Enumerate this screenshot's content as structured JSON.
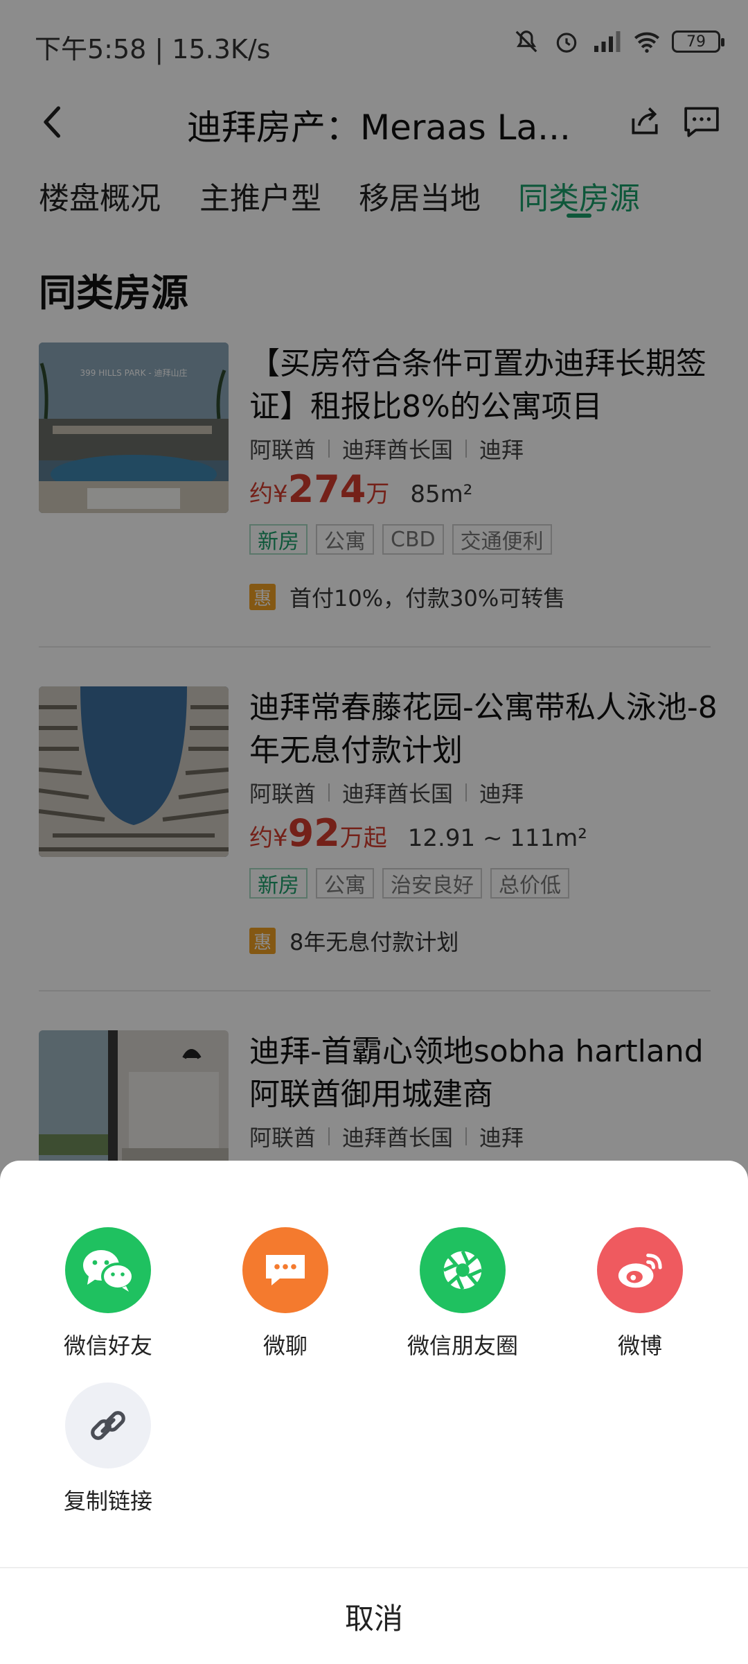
{
  "status_bar": {
    "text": "下午5:58 | 15.3K/s",
    "battery": "79"
  },
  "nav": {
    "title": "迪拜房产：Meraas La..."
  },
  "tabs": [
    {
      "label": "楼盘概况"
    },
    {
      "label": "主推户型"
    },
    {
      "label": "移居当地"
    },
    {
      "label": "同类房源"
    }
  ],
  "section": {
    "title": "同类房源"
  },
  "listings": [
    {
      "title": "【买房符合条件可置办迪拜长期签证】租报比8%的公寓项目",
      "locations": [
        "阿联酋",
        "迪拜酋长国",
        "迪拜"
      ],
      "price_prefix": "约¥",
      "price_num": "274",
      "price_unit": "万",
      "area": "85m²",
      "tags": [
        "新房",
        "公寓",
        "CBD",
        "交通便利"
      ],
      "promo_badge": "惠",
      "promo": "首付10%，付款30%可转售",
      "thumb_text": "399 HILLS PARK - 迪拜山庄"
    },
    {
      "title": "迪拜常春藤花园-公寓带私人泳池-8年无息付款计划",
      "locations": [
        "阿联酋",
        "迪拜酋长国",
        "迪拜"
      ],
      "price_prefix": "约¥",
      "price_num": "92",
      "price_unit": "万起",
      "area": "12.91 ~ 111m²",
      "tags": [
        "新房",
        "公寓",
        "治安良好",
        "总价低"
      ],
      "promo_badge": "惠",
      "promo": "8年无息付款计划"
    },
    {
      "title": "迪拜-首霸心领地sobha hartland阿联酋御用城建商",
      "locations": [
        "阿联酋",
        "迪拜酋长国",
        "迪拜"
      ]
    }
  ],
  "share_sheet": {
    "items": [
      {
        "label": "微信好友",
        "icon": "wechat-icon",
        "color": "#1fc160"
      },
      {
        "label": "微聊",
        "icon": "chat-icon",
        "color": "#f47a2e"
      },
      {
        "label": "微信朋友圈",
        "icon": "moments-icon",
        "color": "#1fc160"
      },
      {
        "label": "微博",
        "icon": "weibo-icon",
        "color": "#ef5a5f"
      },
      {
        "label": "复制链接",
        "icon": "link-icon",
        "color": "#eef0f5"
      }
    ],
    "cancel": "取消"
  },
  "colors": {
    "accent": "#1a9e6a",
    "price": "#d33c2f",
    "promo": "#f0a023"
  }
}
